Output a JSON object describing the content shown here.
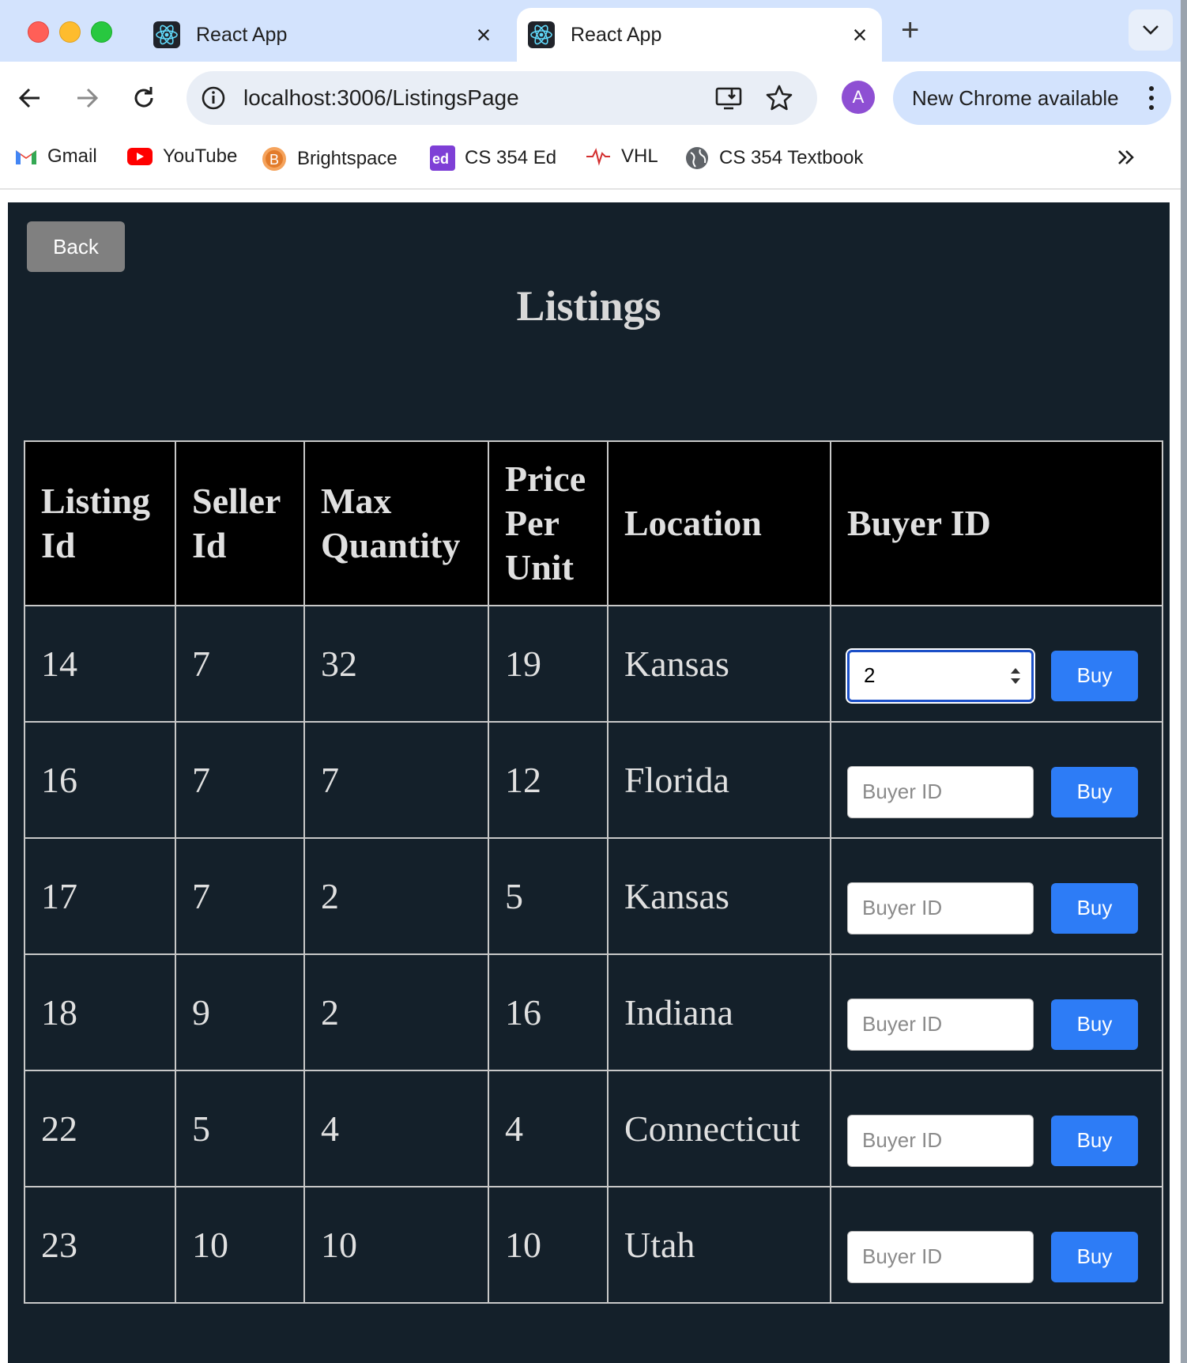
{
  "browser": {
    "tabs": [
      {
        "title": "React App",
        "active": false
      },
      {
        "title": "React App",
        "active": true
      }
    ],
    "address": "localhost:3006/ListingsPage",
    "profile_initial": "A",
    "update_label": "New Chrome available",
    "bookmarks": [
      {
        "label": "Gmail",
        "icon": "gmail-icon"
      },
      {
        "label": "YouTube",
        "icon": "youtube-icon"
      },
      {
        "label": "Brightspace",
        "icon": "brightspace-icon"
      },
      {
        "label": "CS 354 Ed",
        "icon": "ed-icon"
      },
      {
        "label": "VHL",
        "icon": "vhl-icon"
      },
      {
        "label": "CS 354 Textbook",
        "icon": "globe-icon"
      }
    ]
  },
  "page": {
    "back_label": "Back",
    "title": "Listings",
    "table": {
      "headers": [
        "Listing Id",
        "Seller Id",
        "Max Quantity",
        "Price Per Unit",
        "Location",
        "Buyer ID"
      ],
      "rows": [
        {
          "listing_id": "14",
          "seller_id": "7",
          "max_quantity": "32",
          "price_per_unit": "19",
          "location": "Kansas",
          "buyer_value": "2"
        },
        {
          "listing_id": "16",
          "seller_id": "7",
          "max_quantity": "7",
          "price_per_unit": "12",
          "location": "Florida",
          "buyer_value": ""
        },
        {
          "listing_id": "17",
          "seller_id": "7",
          "max_quantity": "2",
          "price_per_unit": "5",
          "location": "Kansas",
          "buyer_value": ""
        },
        {
          "listing_id": "18",
          "seller_id": "9",
          "max_quantity": "2",
          "price_per_unit": "16",
          "location": "Indiana",
          "buyer_value": ""
        },
        {
          "listing_id": "22",
          "seller_id": "5",
          "max_quantity": "4",
          "price_per_unit": "4",
          "location": "Connecticut",
          "buyer_value": ""
        },
        {
          "listing_id": "23",
          "seller_id": "10",
          "max_quantity": "10",
          "price_per_unit": "10",
          "location": "Utah",
          "buyer_value": ""
        }
      ],
      "buyer_placeholder": "Buyer ID",
      "buy_label": "Buy"
    }
  },
  "colors": {
    "page_bg": "#14202a",
    "header_bg": "#000000",
    "buy_button": "#2d7cf6",
    "back_button": "#808080"
  }
}
